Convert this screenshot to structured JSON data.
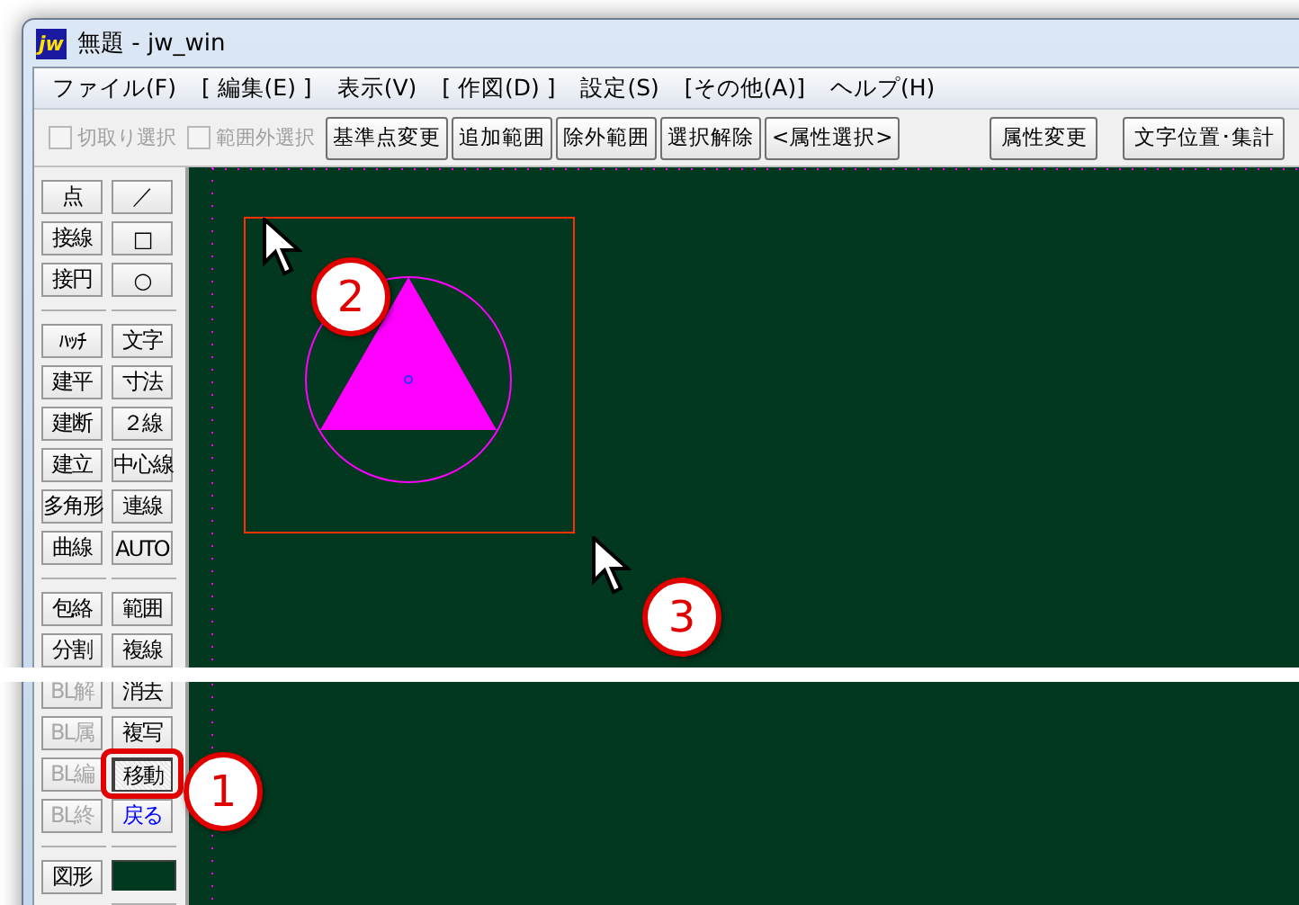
{
  "window": {
    "app_icon": "jw",
    "title": "無題 - jw_win"
  },
  "menu": [
    "ファイル(F)",
    "[ 編集(E) ]",
    "表示(V)",
    "[ 作図(D) ]",
    "設定(S)",
    "[その他(A)]",
    "ヘルプ(H)"
  ],
  "toolbar": {
    "checkboxes": [
      {
        "label": "切取り選択",
        "checked": false,
        "disabled": true
      },
      {
        "label": "範囲外選択",
        "checked": false,
        "disabled": true
      }
    ],
    "buttons": [
      "基準点変更",
      "追加範囲",
      "除外範囲",
      "選択解除",
      "<属性選択>"
    ],
    "right_buttons": [
      "属性変更",
      "文字位置･集計"
    ]
  },
  "toolbox": {
    "left": [
      [
        {
          "label": "点",
          "disabled": false
        },
        {
          "label": "接線",
          "disabled": false
        },
        {
          "label": "接円",
          "disabled": false
        }
      ],
      [
        {
          "label": "ﾊｯﾁ",
          "disabled": false
        },
        {
          "label": "建平",
          "disabled": false
        },
        {
          "label": "建断",
          "disabled": false
        },
        {
          "label": "建立",
          "disabled": false
        },
        {
          "label": "多角形",
          "disabled": false
        },
        {
          "label": "曲線",
          "disabled": false
        }
      ],
      [
        {
          "label": "包絡",
          "disabled": false
        },
        {
          "label": "分割",
          "disabled": false
        },
        {
          "label": "BL解",
          "disabled": true
        },
        {
          "label": "BL属",
          "disabled": true
        },
        {
          "label": "BL編",
          "disabled": true
        },
        {
          "label": "BL終",
          "disabled": true
        }
      ],
      [
        {
          "label": "図形",
          "disabled": false
        }
      ]
    ],
    "right": [
      [
        {
          "kind": "button",
          "label": "／",
          "selected": false
        },
        {
          "kind": "button",
          "label": "□",
          "selected": false
        },
        {
          "kind": "button",
          "label": "○",
          "selected": false
        }
      ],
      [
        {
          "kind": "button",
          "label": "文字",
          "selected": false
        },
        {
          "kind": "button",
          "label": "寸法",
          "selected": false
        },
        {
          "kind": "button",
          "label": "２線",
          "selected": false
        },
        {
          "kind": "button",
          "label": "中心線",
          "selected": false
        },
        {
          "kind": "button",
          "label": "連線",
          "selected": false
        },
        {
          "kind": "button",
          "label": "AUTO",
          "selected": false
        }
      ],
      [
        {
          "kind": "button",
          "label": "範囲",
          "selected": false
        },
        {
          "kind": "button",
          "label": "複線",
          "selected": false
        },
        {
          "kind": "button",
          "label": "消去",
          "selected": false
        },
        {
          "kind": "button",
          "label": "複写",
          "selected": false
        },
        {
          "kind": "button",
          "label": "移動",
          "selected": true
        },
        {
          "kind": "button",
          "label": "戻る",
          "selected": false,
          "color": "#0000ff"
        }
      ],
      [
        {
          "kind": "swatch",
          "color": "#003820"
        }
      ]
    ]
  },
  "callouts": [
    "1",
    "2",
    "3"
  ]
}
